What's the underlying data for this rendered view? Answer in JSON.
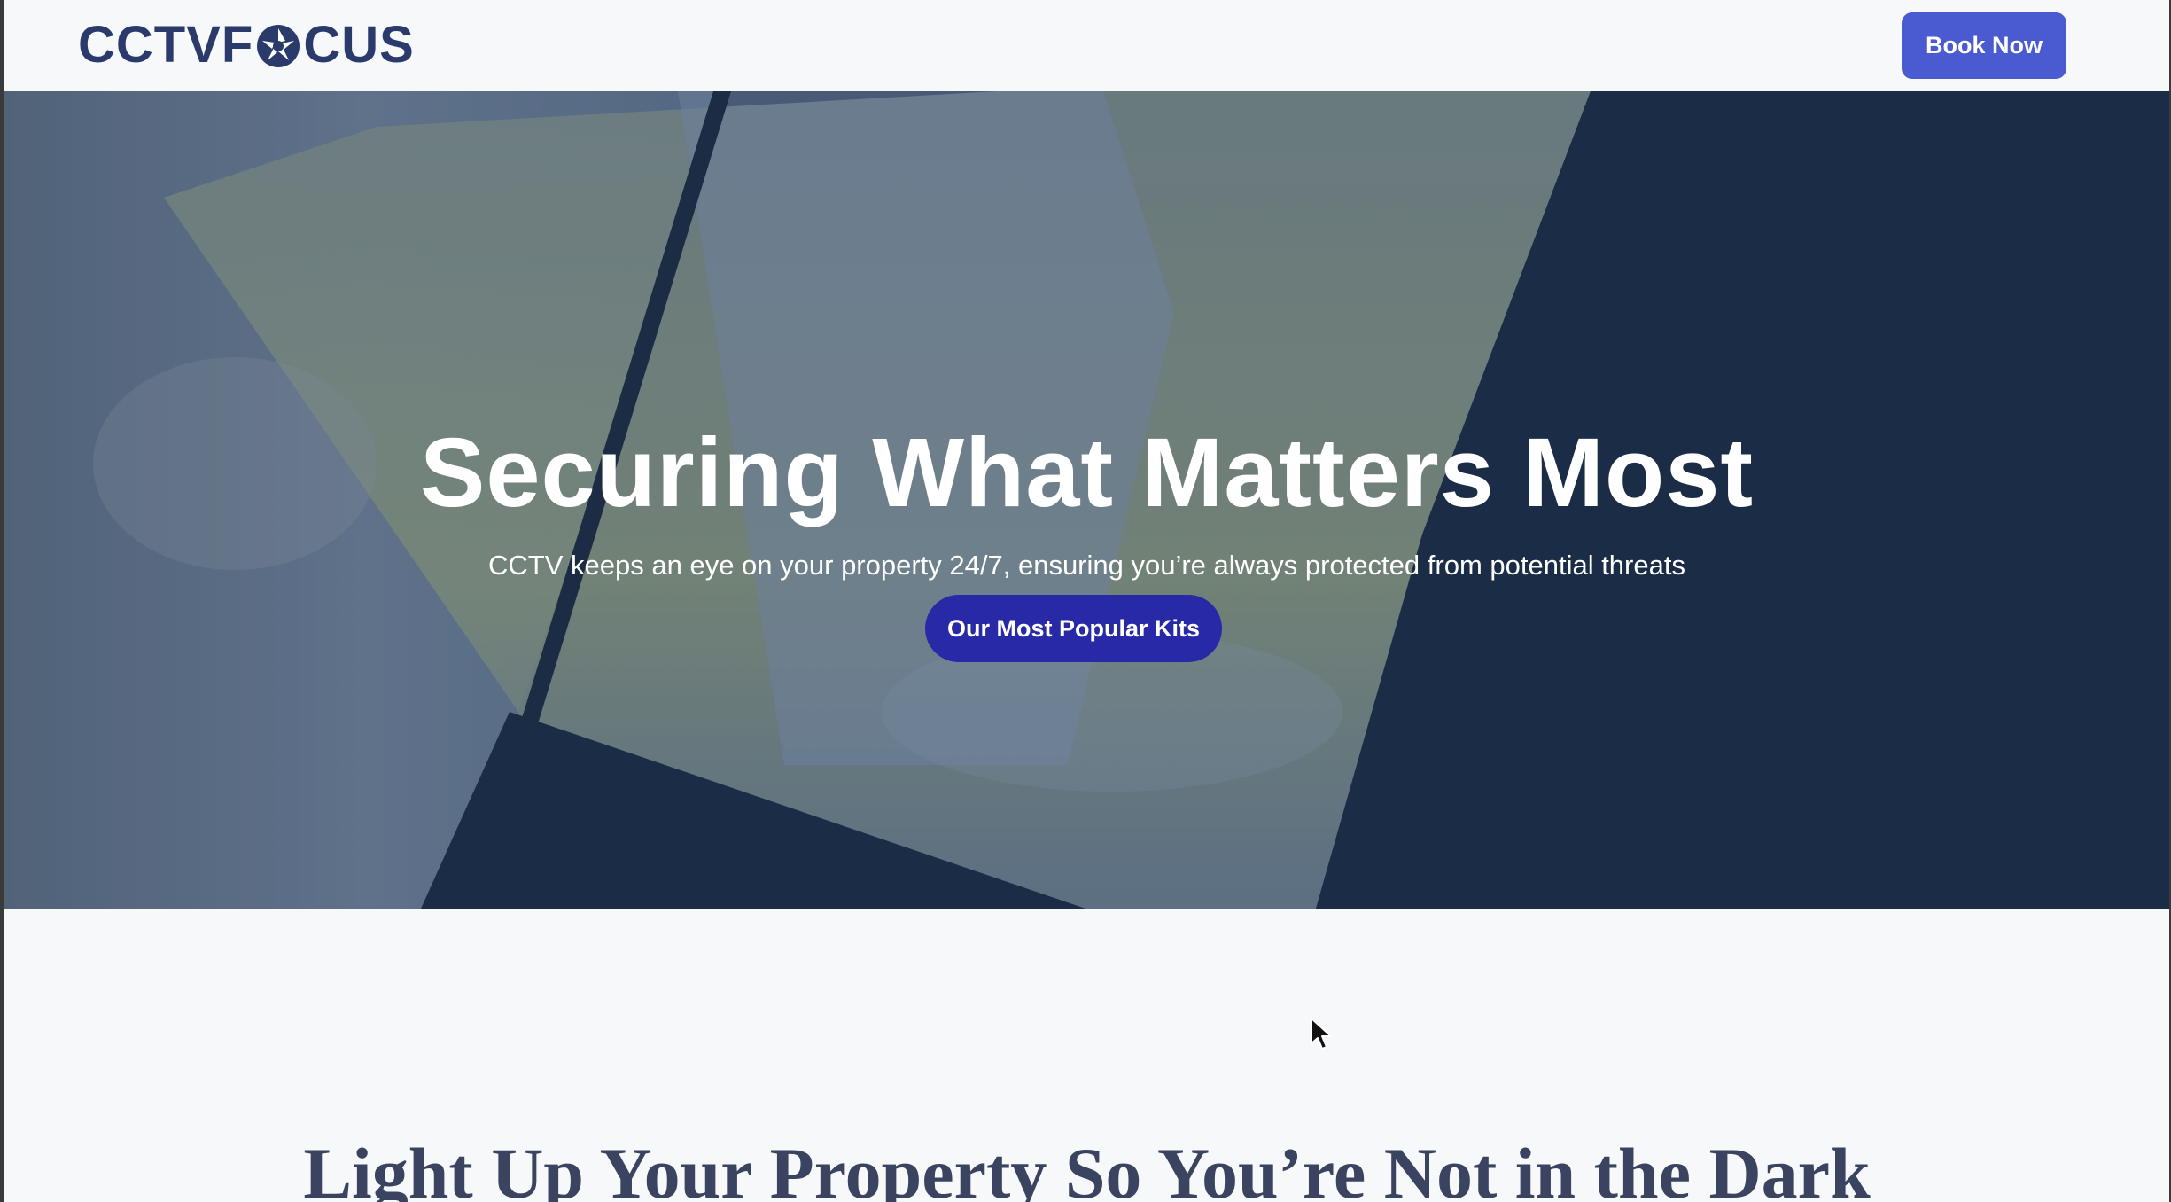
{
  "header": {
    "logo_text_left": "CCTVF",
    "logo_text_right": "CUS",
    "book_label": "Book Now"
  },
  "hero": {
    "title": "Securing What Matters Most",
    "subtitle": "CCTV keeps an eye on your property 24/7, ensuring you’re always protected from potential threats",
    "cta_label": "Our Most Popular Kits"
  },
  "section": {
    "title": "Light Up Your Property So You’re Not in the Dark"
  },
  "colors": {
    "brand_navy": "#2a3a6b",
    "book_button": "#4a5ad0",
    "cta_button": "#2729a6",
    "hero_dark": "#1b2d47",
    "page_bg": "#f7f8fa"
  },
  "icons": {
    "logo_aperture": "camera-aperture-icon",
    "cursor": "mouse-pointer-icon"
  }
}
